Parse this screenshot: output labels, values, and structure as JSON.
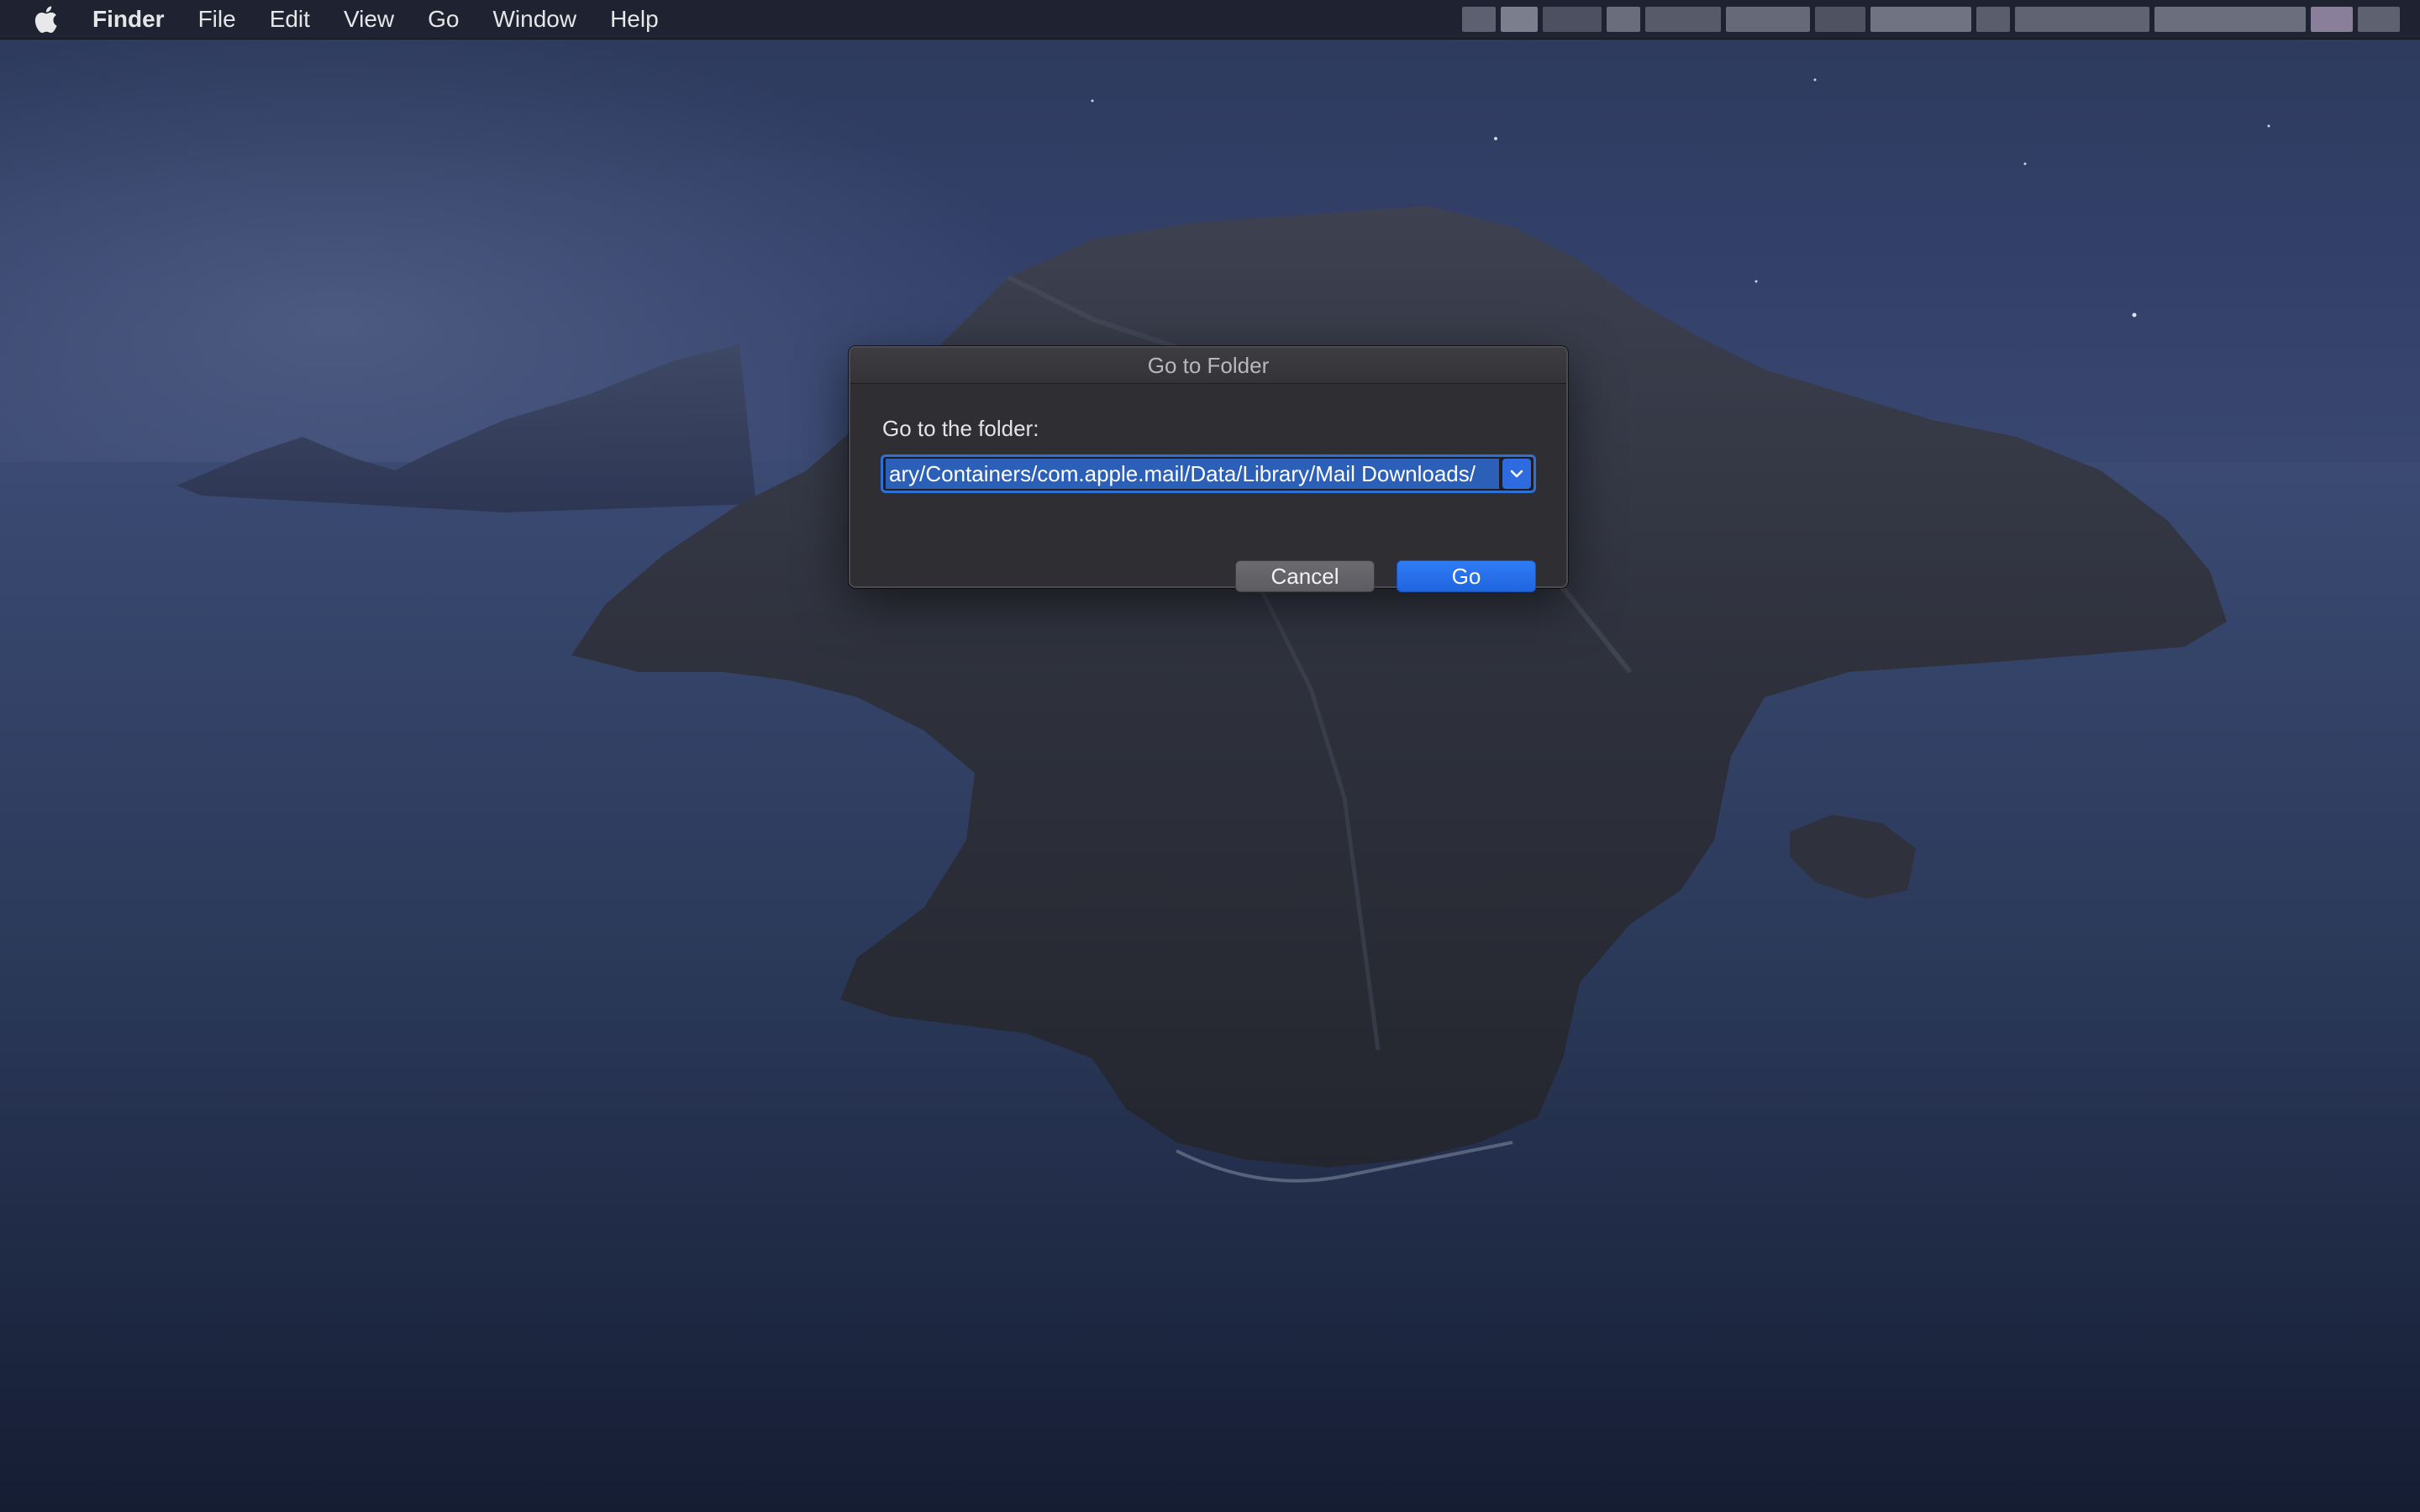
{
  "menubar": {
    "app_name": "Finder",
    "items": [
      "File",
      "Edit",
      "View",
      "Go",
      "Window",
      "Help"
    ],
    "apple_icon": "apple-logo-icon"
  },
  "dialog": {
    "title": "Go to Folder",
    "prompt": "Go to the folder:",
    "path_value": "ary/Containers/com.apple.mail/Data/Library/Mail Downloads/",
    "dropdown_icon": "chevron-down-icon",
    "cancel_label": "Cancel",
    "go_label": "Go"
  },
  "colors": {
    "accent": "#2e6be0",
    "menubar_bg": "#1e212d",
    "dialog_bg": "#2f2f33"
  }
}
